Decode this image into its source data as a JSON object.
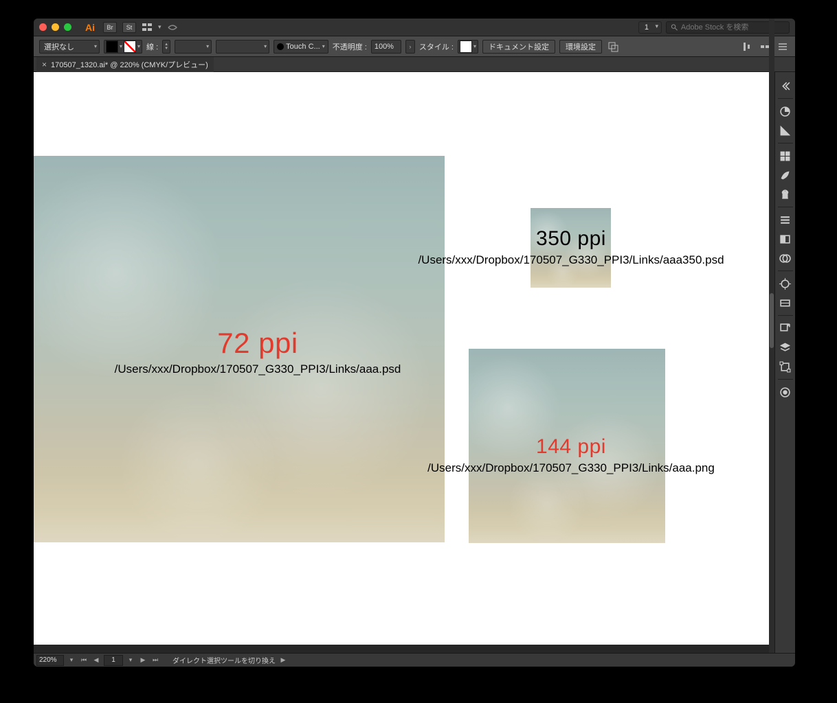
{
  "titlebar": {
    "app": "Ai",
    "bridge": "Br",
    "stock": "St",
    "workspace": "1",
    "search_placeholder": "Adobe Stock を検索"
  },
  "controlbar": {
    "selection": "選択なし",
    "stroke_label": "線 :",
    "touch_label": "Touch C...",
    "opacity_label": "不透明度 :",
    "opacity_value": "100%",
    "style_label": "スタイル :",
    "doc_setup": "ドキュメント設定",
    "prefs": "環境設定"
  },
  "tab": {
    "title": "170507_1320.ai* @ 220% (CMYK/プレビュー)"
  },
  "canvas": {
    "item1": {
      "ppi": "72 ppi",
      "path": "/Users/xxx/Dropbox/170507_G330_PPI3/Links/aaa.psd"
    },
    "item2": {
      "ppi": "350 ppi",
      "path": "/Users/xxx/Dropbox/170507_G330_PPI3/Links/aaa350.psd"
    },
    "item3": {
      "ppi": "144 ppi",
      "path": "/Users/xxx/Dropbox/170507_G330_PPI3/Links/aaa.png"
    }
  },
  "statusbar": {
    "zoom": "220%",
    "page": "1",
    "hint": "ダイレクト選択ツールを切り換え"
  }
}
